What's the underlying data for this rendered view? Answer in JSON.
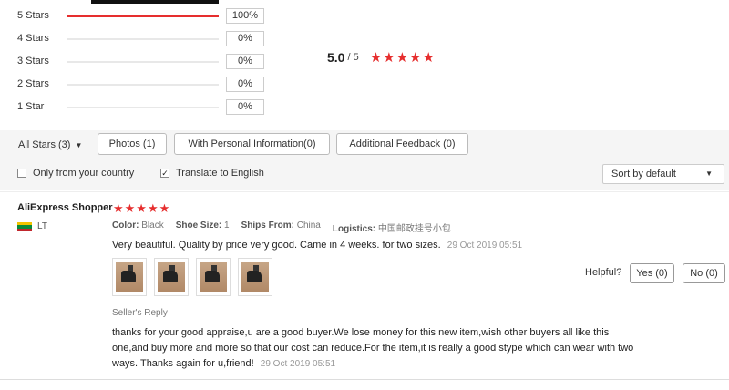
{
  "rating_breakdown": [
    {
      "label": "5 Stars",
      "fraction": 1.0,
      "percent": "100%"
    },
    {
      "label": "4 Stars",
      "fraction": 0.0,
      "percent": "0%"
    },
    {
      "label": "3 Stars",
      "fraction": 0.0,
      "percent": "0%"
    },
    {
      "label": "2 Stars",
      "fraction": 0.0,
      "percent": "0%"
    },
    {
      "label": "1 Star",
      "fraction": 0.0,
      "percent": "0%"
    }
  ],
  "summary": {
    "score": "5.0",
    "out_of": "/ 5",
    "stars": "★★★★★"
  },
  "filters": {
    "all_stars": "All Stars (3)",
    "photos": "Photos (1)",
    "personal_info": "With Personal Information(0)",
    "additional_feedback": "Additional Feedback (0)",
    "only_country": "Only from your country",
    "translate": "Translate to English",
    "translate_checked": "✓",
    "sort": "Sort by default"
  },
  "review": {
    "reviewer": "AliExpress Shopper",
    "stars": "★★★★★",
    "country_code": "LT",
    "attrs": [
      {
        "key": "Color:",
        "value": "Black"
      },
      {
        "key": "Shoe Size:",
        "value": "1"
      },
      {
        "key": "Ships From:",
        "value": "China"
      },
      {
        "key": "Logistics:",
        "value": "中国邮政挂号小包"
      }
    ],
    "content": "Very beautiful. Quality by price very good. Came in 4 weeks. for two sizes.",
    "date": "29 Oct 2019 05:51",
    "helpful_label": "Helpful?",
    "yes_label": "Yes (0)",
    "no_label": "No (0)",
    "reply_title": "Seller's Reply",
    "reply_text": "thanks for your good appraise,u are a good buyer.We lose money for this new item,wish other buyers all like this one,and buy more and more so that our cost can reduce.For the item,it is really a good stype which can wear with two ways. Thanks again for u,friend!",
    "reply_date": "29 Oct 2019 05:51"
  },
  "colors": {
    "accent": "#e62e2e",
    "flag_yellow": "#f2c300",
    "flag_green": "#0a8a3a",
    "flag_red": "#c1272d"
  }
}
